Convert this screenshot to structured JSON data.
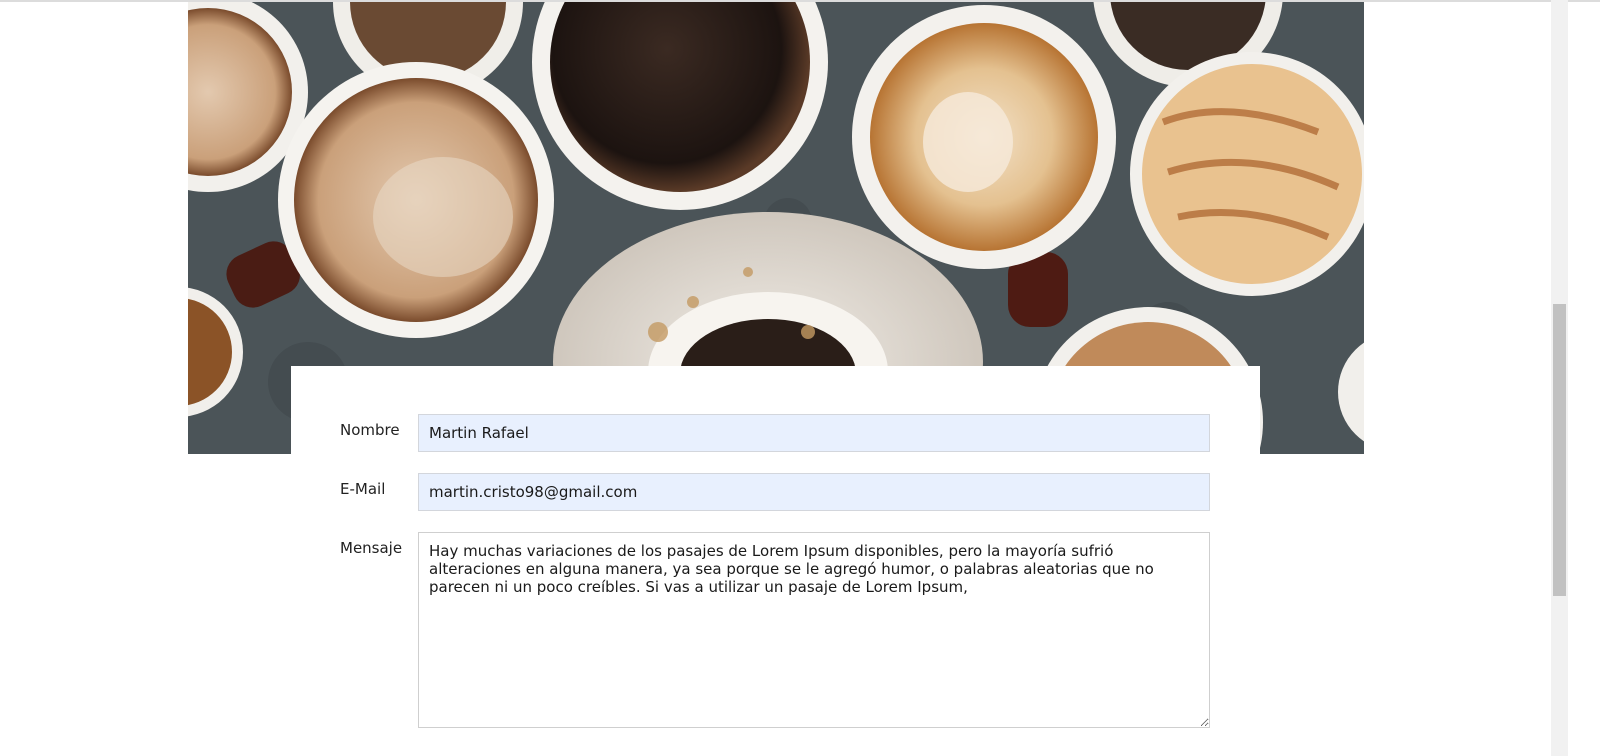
{
  "hero": {
    "image_name": "coffee-cups-photo"
  },
  "form": {
    "name_label": "Nombre",
    "name_value": "Martin Rafael",
    "email_label": "E-Mail",
    "email_value": "martin.cristo98@gmail.com",
    "message_label": "Mensaje",
    "message_value": "Hay muchas variaciones de los pasajes de Lorem Ipsum disponibles, pero la mayoría sufrió alteraciones en alguna manera, ya sea porque se le agregó humor, o palabras aleatorias que no parecen ni un poco creíbles. Si vas a utilizar un pasaje de Lorem Ipsum,"
  },
  "colors": {
    "autofill_background": "#e8f0fe",
    "hero_background": "#4a5256"
  }
}
